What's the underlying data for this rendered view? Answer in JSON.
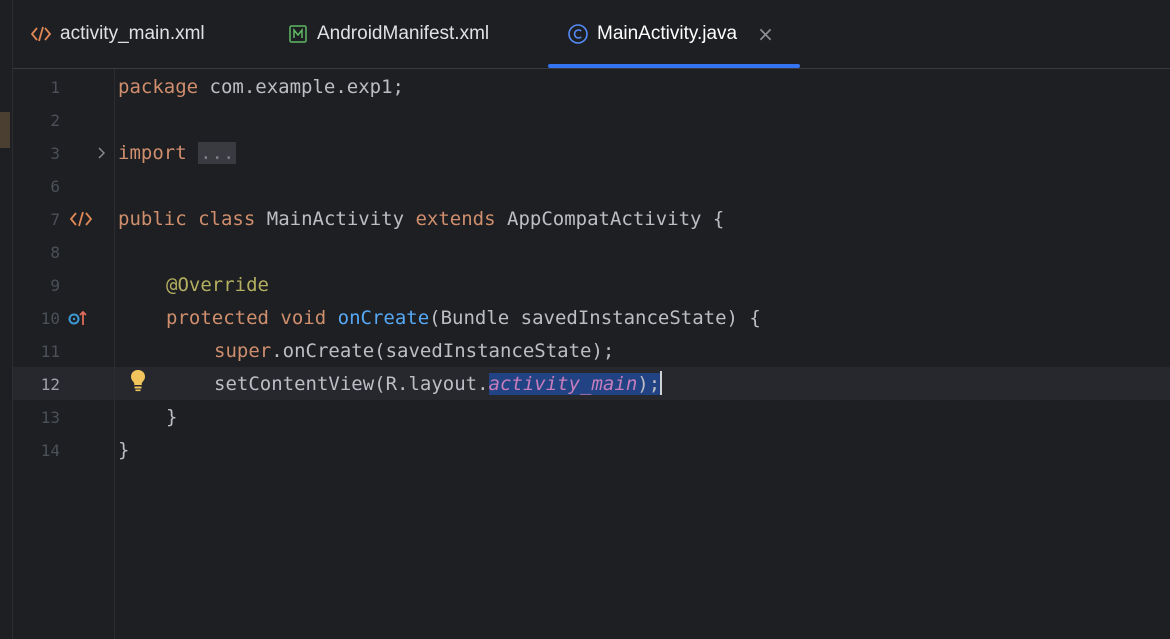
{
  "tabs": [
    {
      "label": "activity_main.xml",
      "icon": "xml-code-icon",
      "active": false
    },
    {
      "label": "AndroidManifest.xml",
      "icon": "manifest-icon",
      "active": false
    },
    {
      "label": "MainActivity.java",
      "icon": "class-icon",
      "active": true,
      "close_glyph": "×"
    }
  ],
  "colors": {
    "background": "#1e1f22",
    "keyword": "#cf8e6d",
    "function": "#56a8f5",
    "annotation": "#b3ae60",
    "field": "#c77dbb",
    "text": "#bcbec4",
    "tab_accent": "#3574f0",
    "selection": "#214283"
  },
  "editor": {
    "line_numbers": [
      "1",
      "2",
      "3",
      "6",
      "7",
      "8",
      "9",
      "10",
      "11",
      "12",
      "13",
      "14"
    ],
    "current_line": "12",
    "code": {
      "l1_kw": "package",
      "l1_rest": " com.example.exp1;",
      "l3_kw": "import",
      "l3_fold": "...",
      "l7_kw1": "public",
      "l7_kw2": "class",
      "l7_name": "MainActivity",
      "l7_kw3": "extends",
      "l7_rest": "AppCompatActivity {",
      "l9_ann": "@Override",
      "l10_kw1": "protected",
      "l10_kw2": "void",
      "l10_fn": "onCreate",
      "l10_rest": "(Bundle savedInstanceState) {",
      "l11_kw": "super",
      "l11_rest": ".onCreate(savedInstanceState);",
      "l12_pre": "setContentView(R.layout.",
      "l12_field": "activity_main",
      "l12_post": ");",
      "l13": "}",
      "l14": "}"
    },
    "gutter_icons": {
      "line3": "fold-chevron-icon",
      "line7": "code-tag-icon",
      "line10": "override-method-icon",
      "line12": "lightbulb-icon"
    }
  }
}
